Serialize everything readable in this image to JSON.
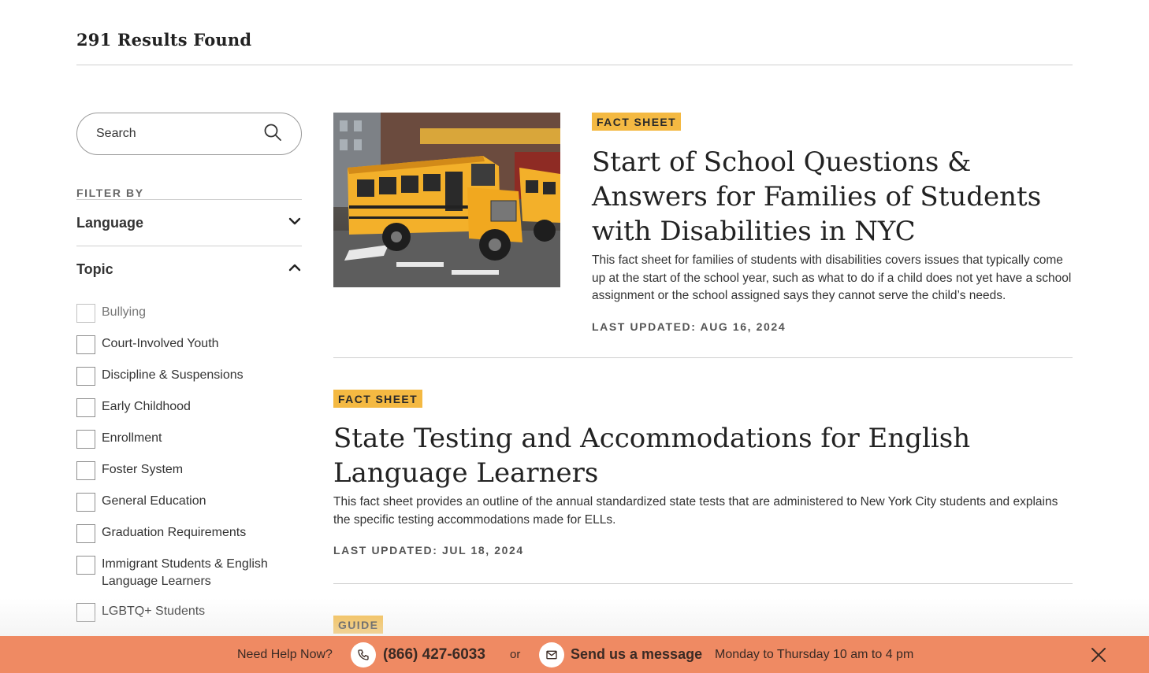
{
  "header": {
    "results_count": "291 Results Found"
  },
  "sidebar": {
    "search_placeholder": "Search",
    "filter_label": "FILTER BY",
    "sections": [
      {
        "title": "Language",
        "state": "collapsed"
      },
      {
        "title": "Topic",
        "state": "expanded"
      }
    ],
    "topics": [
      "Bullying",
      "Court-Involved Youth",
      "Discipline & Suspensions",
      "Early Childhood",
      "Enrollment",
      "Foster System",
      "General Education",
      "Graduation Requirements",
      "Immigrant Students & English Language Learners",
      "LGBTQ+ Students"
    ]
  },
  "results": [
    {
      "badge": "FACT SHEET",
      "title": "Start of School Questions & Answers for Families of Students with Disabilities in NYC",
      "description": "This fact sheet for families of students with disabilities covers issues that typically come up at the start of the school year, such as what to do if a child does not yet have a school assignment or the school assigned says they cannot serve the child’s needs.",
      "updated": "LAST UPDATED: AUG 16, 2024",
      "image": "school-bus-photo"
    },
    {
      "badge": "FACT SHEET",
      "title": "State Testing and Accommodations for English Language Learners",
      "description": "This fact sheet provides an outline of the annual standardized state tests that are administered to New York City students and explains the specific testing accommodations made for ELLs.",
      "updated": "LAST UPDATED: JUL 18, 2024"
    },
    {
      "badge": "GUIDE"
    }
  ],
  "help_bar": {
    "need_help": "Need Help Now?",
    "phone": "(866) 427-6033",
    "or": "or",
    "message": "Send us a message",
    "hours": "Monday to Thursday 10 am to 4 pm"
  },
  "colors": {
    "badge": "#f4b942",
    "help_bar": "#ef8a63",
    "divider": "#cfcfcf"
  }
}
